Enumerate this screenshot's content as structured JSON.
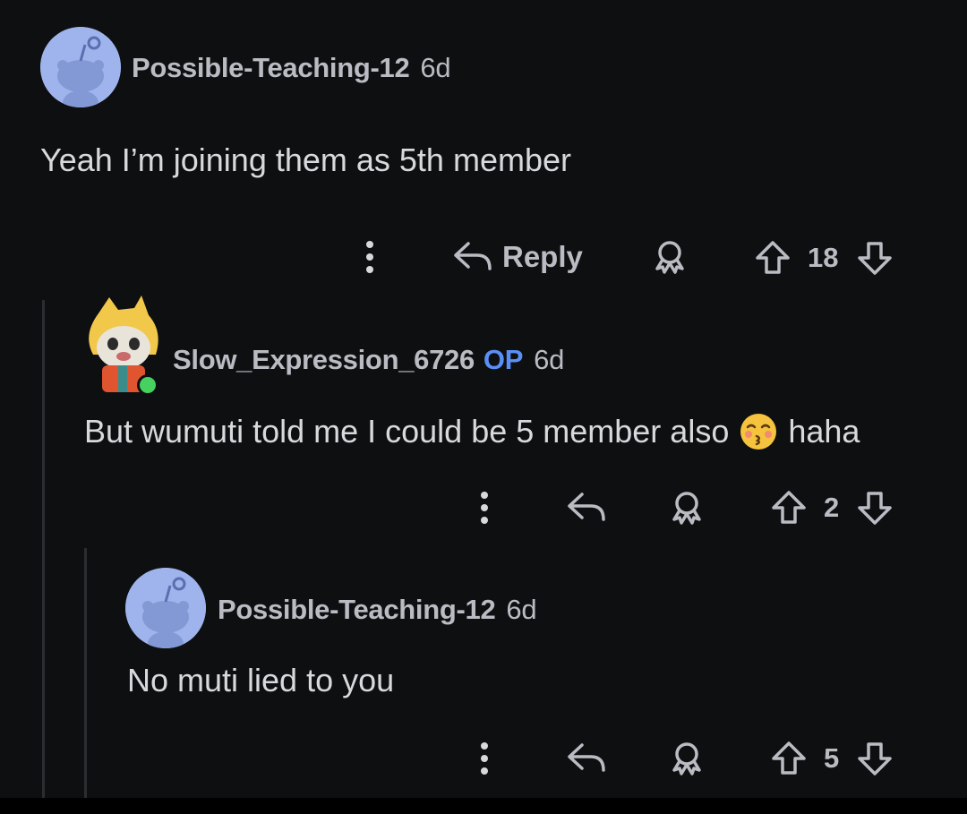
{
  "comments": [
    {
      "author": "Possible-Teaching-12",
      "age": "6d",
      "text": "Yeah I’m joining them as 5th member",
      "reply_label": "Reply",
      "votes": "18"
    },
    {
      "author": "Slow_Expression_6726",
      "op_badge": "OP",
      "age": "6d",
      "text": "But wumuti told me I could be 5 member also",
      "text_after_emoji": "haha",
      "votes": "2"
    },
    {
      "author": "Possible-Teaching-12",
      "age": "6d",
      "text": "No muti lied to you",
      "votes": "5"
    }
  ],
  "colors": {
    "background": "#0e0f11",
    "text": "#d7dadc",
    "muted": "#b9bcc2",
    "op_badge": "#5a8ff5",
    "online_dot": "#46d160",
    "avatar_bg": "#9fb4ec"
  },
  "icons": [
    "overflow-dots-icon",
    "reply-arrow-icon",
    "award-icon",
    "upvote-icon",
    "downvote-icon",
    "snoo-avatar-icon",
    "kissing-face-emoji-icon"
  ]
}
